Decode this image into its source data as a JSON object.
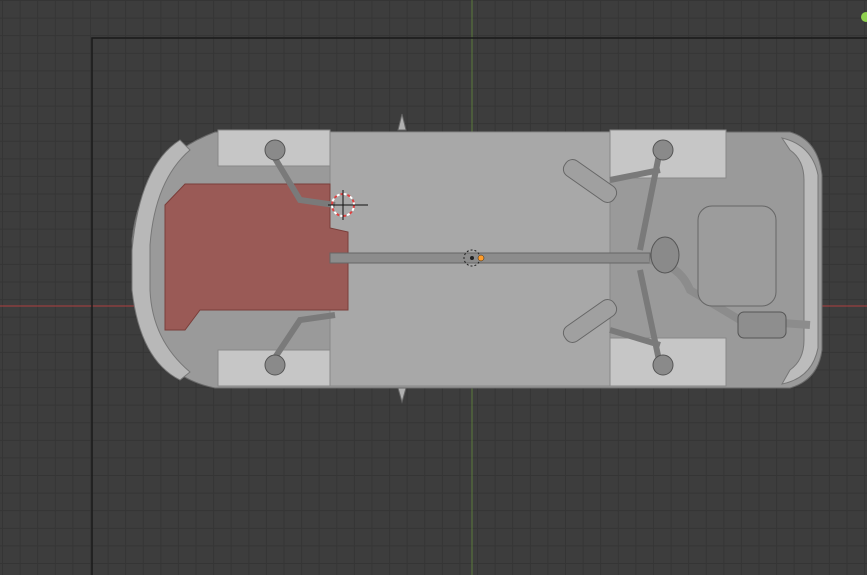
{
  "viewport": {
    "background_color": "#3d3d3d",
    "grid_color": "#353535",
    "x_axis_color": "#b04040",
    "y_axis_color": "#5a7a3a",
    "camera_frame_color": "#1a1a1a"
  },
  "model": {
    "body_color": "#9a9a9a",
    "floor_color": "#a8a8a8",
    "selected_part_color": "#9a5a56",
    "wheel_well_color": "#c8c8c8",
    "detail_color": "#7a7a7a"
  },
  "icons": {
    "origin": "object-origin-icon",
    "cursor_3d": "3d-cursor-icon",
    "gizmo": "navigation-gizmo-icon"
  },
  "overlay_colors": {
    "origin_color": "#ff9c2a",
    "cursor_color": "#e04040",
    "gizmo_color": "#8fd14f"
  }
}
